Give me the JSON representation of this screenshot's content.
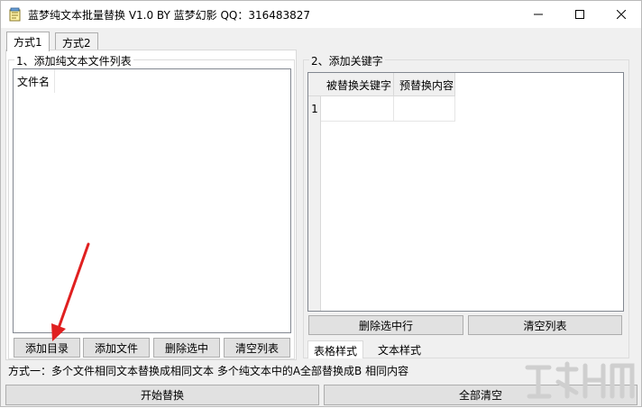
{
  "window": {
    "title": "蓝梦纯文本批量替换 V1.0 BY 蓝梦幻影 QQ：316483827"
  },
  "tabs": [
    {
      "label": "方式1",
      "active": true
    },
    {
      "label": "方式2",
      "active": false
    }
  ],
  "left_group": {
    "title": "1、添加纯文本文件列表",
    "column_header": "文件名",
    "buttons": {
      "add_dir": "添加目录",
      "add_file": "添加文件",
      "delete_selected": "删除选中",
      "clear_list": "清空列表"
    }
  },
  "right_group": {
    "title": "2、添加关键字",
    "grid": {
      "headers": [
        "被替换关键字",
        "预替换内容"
      ],
      "row_number": "1"
    },
    "buttons": {
      "delete_selected_row": "删除选中行",
      "clear_list": "清空列表"
    },
    "subtabs": [
      {
        "label": "表格样式",
        "active": true
      },
      {
        "label": "文本样式",
        "active": false
      }
    ]
  },
  "status_text": "方式一：多个文件相同文本替换成相同文本   多个纯文本中的A全部替换成B 相同内容",
  "bottom_buttons": {
    "start": "开始替换",
    "clear_all": "全部清空"
  },
  "icons": {
    "app": "notepad-icon",
    "minimize": "minimize-icon",
    "maximize": "maximize-icon",
    "close": "close-icon"
  },
  "colors": {
    "annotation_arrow": "#e02020"
  }
}
